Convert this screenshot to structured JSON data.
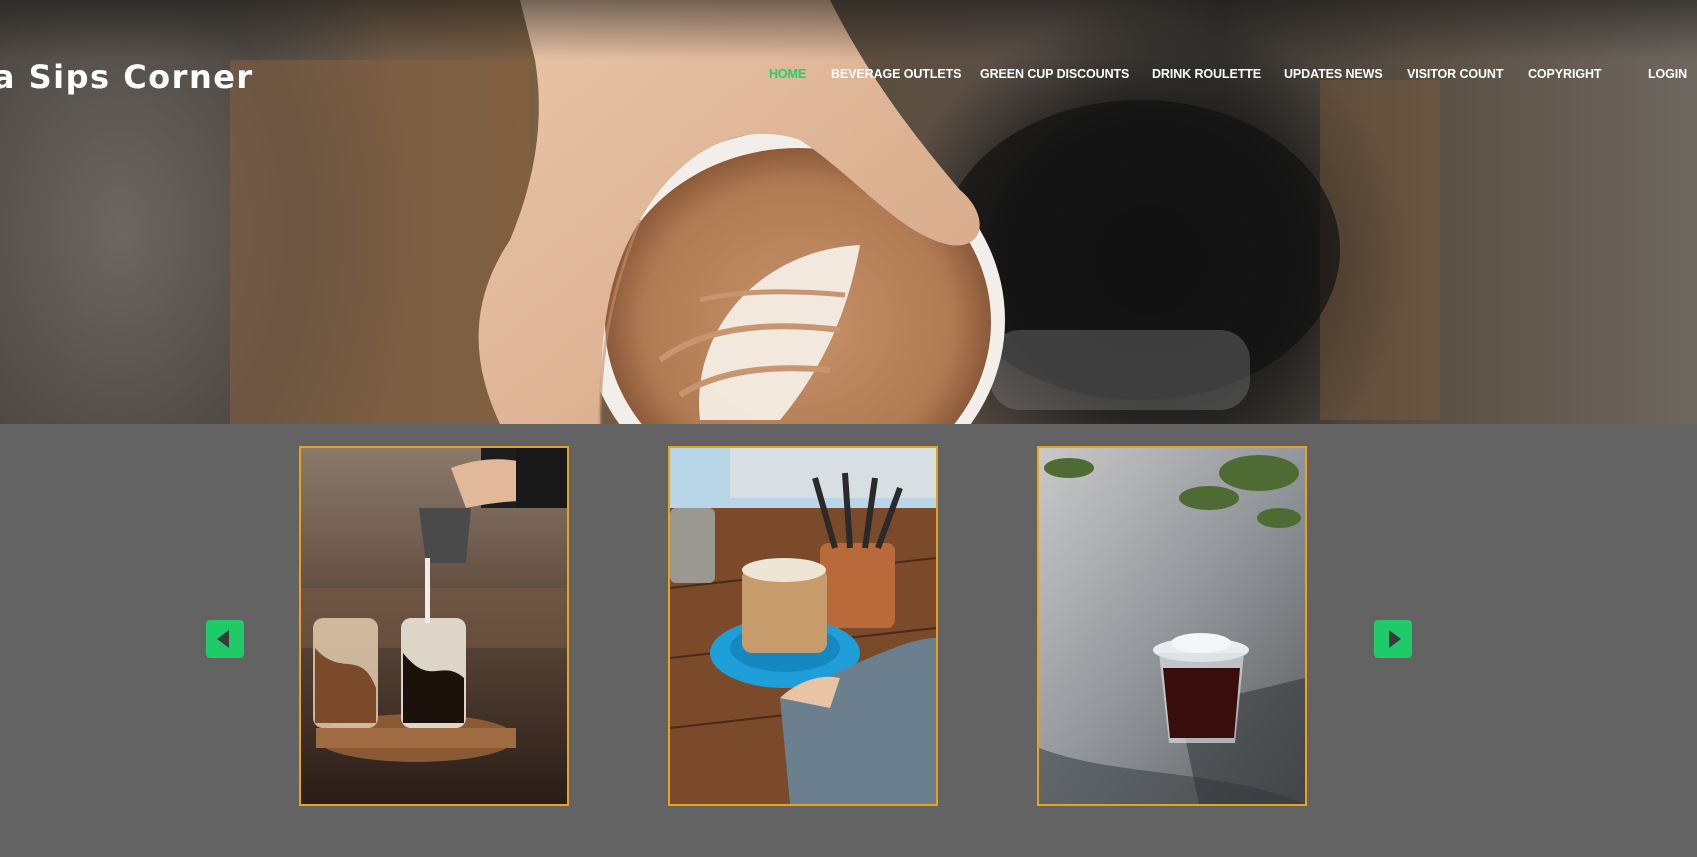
{
  "header": {
    "brand": "ma Sips Corner",
    "nav": [
      {
        "label": "HOME",
        "active": true
      },
      {
        "label": "BEVERAGE OUTLETS",
        "active": false
      },
      {
        "label": "GREEN CUP DISCOUNTS",
        "active": false
      },
      {
        "label": "DRINK ROULETTE",
        "active": false
      },
      {
        "label": "UPDATES NEWS",
        "active": false
      },
      {
        "label": "VISITOR COUNT",
        "active": false
      },
      {
        "label": "COPYRIGHT",
        "active": false
      },
      {
        "label": "LOGIN",
        "active": false
      }
    ]
  },
  "hero": {
    "image": "hand-holding-latte-art-cup"
  },
  "carousel": {
    "prev_icon": "triangle-left-icon",
    "next_icon": "triangle-right-icon",
    "cards": [
      {
        "image": "iced-coffee-milk-pour"
      },
      {
        "image": "iced-latte-glass-on-table"
      },
      {
        "image": "iced-americano-takeaway-cup"
      }
    ]
  },
  "colors": {
    "accent_green": "#1fd173",
    "card_border": "#e8a21c",
    "page_background": "#636363"
  }
}
